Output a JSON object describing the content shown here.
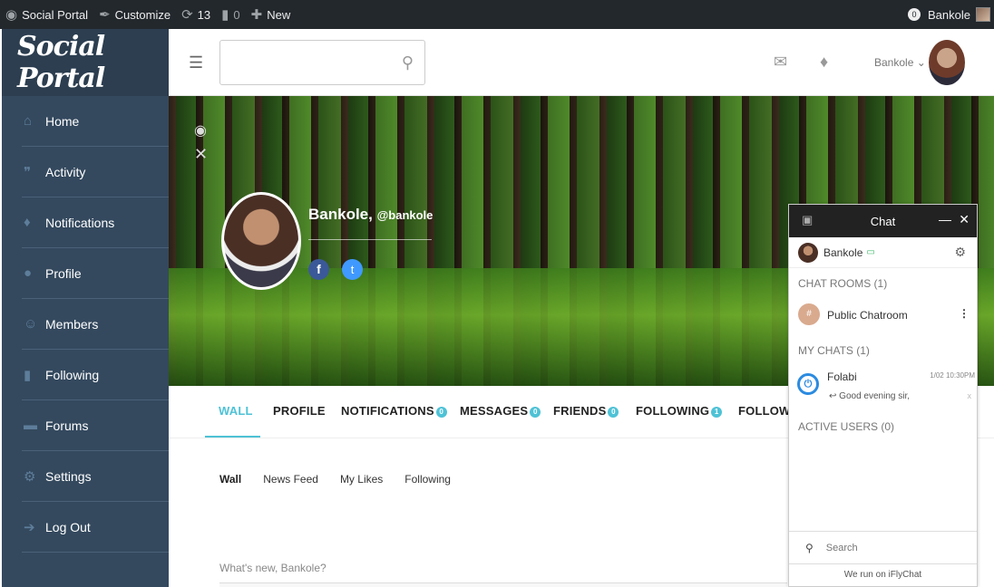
{
  "adminbar": {
    "site": "Social Portal",
    "customize": "Customize",
    "updates": "13",
    "comments": "0",
    "new": "New",
    "user_count": "0",
    "user": "Bankole"
  },
  "sidebar": {
    "logo": "Social Portal",
    "items": [
      {
        "label": "Home",
        "icon": "home-icon"
      },
      {
        "label": "Activity",
        "icon": "quote-icon"
      },
      {
        "label": "Notifications",
        "icon": "bell-icon"
      },
      {
        "label": "Profile",
        "icon": "user-icon"
      },
      {
        "label": "Members",
        "icon": "smile-icon"
      },
      {
        "label": "Following",
        "icon": "bookmark-icon"
      },
      {
        "label": "Forums",
        "icon": "chat-icon"
      },
      {
        "label": "Settings",
        "icon": "gears-icon"
      },
      {
        "label": "Log Out",
        "icon": "logout-icon"
      }
    ]
  },
  "topbar": {
    "search_placeholder": "",
    "username": "Bankole"
  },
  "profile": {
    "name": "Bankole,",
    "handle": "@bankole",
    "fb": "f",
    "tw": "t"
  },
  "tabs": [
    {
      "label": "WALL",
      "badge": ""
    },
    {
      "label": "PROFILE",
      "badge": ""
    },
    {
      "label": "NOTIFICATIONS",
      "badge": "0"
    },
    {
      "label": "MESSAGES",
      "badge": "0"
    },
    {
      "label": "FRIENDS",
      "badge": "0"
    },
    {
      "label": "FOLLOWING",
      "badge": "1"
    },
    {
      "label": "FOLLOWEI",
      "badge": ""
    }
  ],
  "subnav": [
    "Wall",
    "News Feed",
    "My Likes",
    "Following"
  ],
  "whats_new": "What's new, Bankole?",
  "chat": {
    "title": "Chat",
    "user": "Bankole",
    "rooms_header": "CHAT ROOMS (1)",
    "room_name": "Public Chatroom",
    "room_icon": "#",
    "mychats_header": "MY CHATS (1)",
    "chat_name": "Folabi",
    "chat_time": "1/02 10:30PM",
    "chat_msg": "Good evening sir,",
    "chat_x": "x",
    "active_header": "ACTIVE USERS (0)",
    "search_placeholder": "Search",
    "footer": "We run on iFlyChat"
  },
  "colors": {
    "accent": "#4ec2d6",
    "sidebar": "#34495e",
    "adminbar": "#23282d"
  }
}
